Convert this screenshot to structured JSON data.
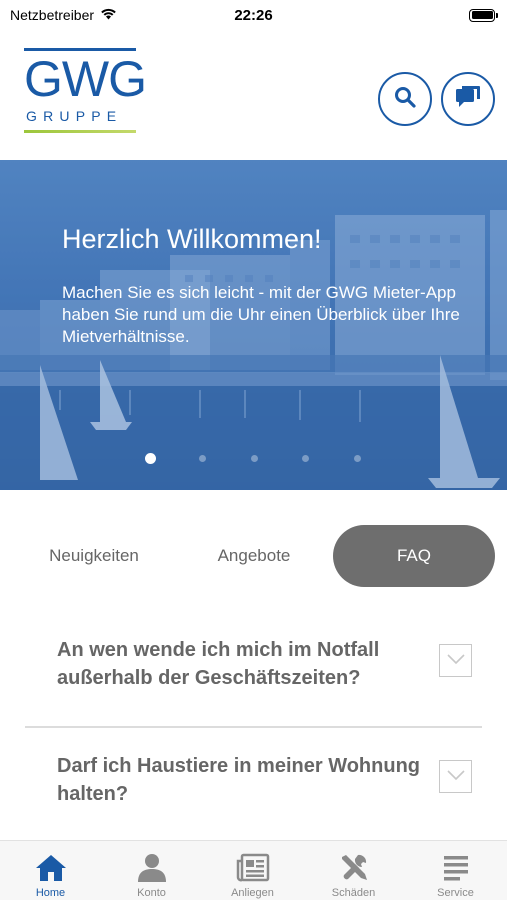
{
  "status_bar": {
    "carrier": "Netzbetreiber",
    "time": "22:26"
  },
  "header": {
    "logo": {
      "text": "GWG",
      "subtext": "GRUPPE"
    },
    "search_icon": "search-icon",
    "chat_icon": "chat-icon"
  },
  "hero": {
    "title": "Herzlich Willkommen!",
    "text": "Machen Sie es sich leicht -  mit der GWG Mieter-App haben Sie rund um die Uhr einen Überblick über Ihre Mietverhältnisse.",
    "carousel_index": 1,
    "carousel_count": 5
  },
  "tabs": {
    "items": [
      {
        "label": "Neuigkeiten"
      },
      {
        "label": "Angebote"
      },
      {
        "label": "FAQ"
      }
    ],
    "selected": "FAQ"
  },
  "faq": {
    "items": [
      {
        "question": "An wen wende ich mich im Notfall außerhalb der Geschäftszeiten?"
      },
      {
        "question": "Darf ich Haustiere in meiner Wohnung halten?"
      }
    ]
  },
  "tabbar": {
    "items": [
      {
        "label": "Home",
        "icon": "home-icon"
      },
      {
        "label": "Konto",
        "icon": "person-icon"
      },
      {
        "label": "Anliegen",
        "icon": "newspaper-icon"
      },
      {
        "label": "Schäden",
        "icon": "tools-icon"
      },
      {
        "label": "Service",
        "icon": "menu-lines-icon"
      }
    ],
    "selected": "Home"
  },
  "colors": {
    "brand_blue": "#1a5aa6",
    "brand_green": "#9cc63b",
    "tab_active_bg": "#6e6e6e",
    "text_grey": "#666666"
  }
}
